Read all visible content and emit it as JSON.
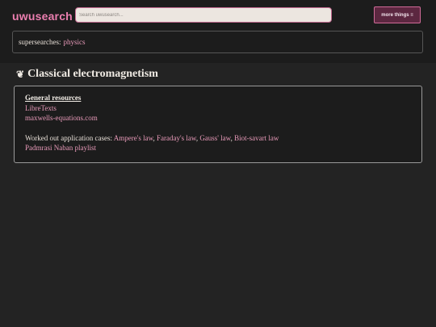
{
  "header": {
    "logo": "uwusearch",
    "search_placeholder": "Search uwusearch...",
    "more_button": "more things ≡"
  },
  "supersearch": {
    "label": "supersearches:",
    "items": [
      "physics"
    ]
  },
  "section": {
    "icon": "❦",
    "title": "Classical electromagnetism"
  },
  "card": {
    "heading": "General resources",
    "links": [
      "LibreTexts",
      "maxwells-equations.com"
    ],
    "applications_label": "Worked out application cases:",
    "applications": [
      "Ampere's law",
      "Faraday's law",
      "Gauss' law",
      "Biot-savart law"
    ],
    "playlist": "Padmrasi Naban playlist"
  },
  "colors": {
    "background": "#232323",
    "accent": "#ec7fb0",
    "link": "#e89ab9"
  }
}
